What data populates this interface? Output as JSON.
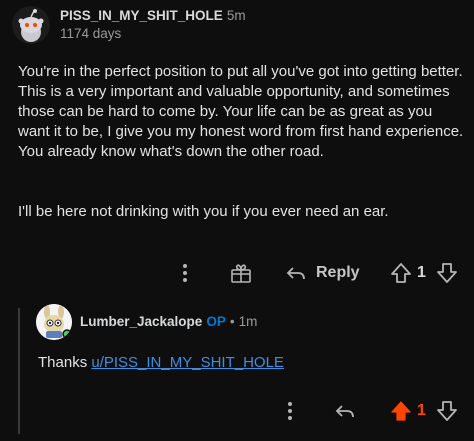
{
  "comment": {
    "username": "PISS_IN_MY_SHIT_HOLE",
    "time": "5m",
    "badge": "1174 days",
    "paragraphs": [
      "You're in the perfect position to put all you've got into getting better.  This is a very important and valuable opportunity, and sometimes those can be hard to come by.  Your life can be as great as you want it to be, I give you my honest word from first hand experience.  You already know what's down the other road.",
      "I'll be here not drinking with you if you ever need an ear."
    ],
    "actions": {
      "more_icon": "more-vertical-icon",
      "award_icon": "award-icon",
      "reply_label": "Reply",
      "vote_count": "1"
    }
  },
  "reply": {
    "username": "Lumber_Jackalope",
    "op_badge": "OP",
    "separator": "•",
    "time": "1m",
    "text_prefix": "Thanks ",
    "mention": "u/PISS_IN_MY_SHIT_HOLE",
    "actions": {
      "vote_count": "1"
    }
  },
  "colors": {
    "upvote_active": "#ff4500",
    "op": "#0079d3",
    "link": "#3d8fe0",
    "background": "#0e0e0e"
  }
}
